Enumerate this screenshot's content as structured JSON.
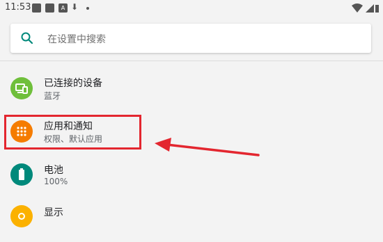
{
  "status_bar": {
    "time": "11:53"
  },
  "search": {
    "placeholder": "在设置中搜索"
  },
  "settings_items": [
    {
      "title": "已连接的设备",
      "subtitle": "蓝牙",
      "icon": "devices-icon",
      "color": "#6fbf3b"
    },
    {
      "title": "应用和通知",
      "subtitle": "权限、默认应用",
      "icon": "apps-icon",
      "color": "#f57c00"
    },
    {
      "title": "电池",
      "subtitle": "100%",
      "icon": "battery-icon",
      "color": "#00897b"
    },
    {
      "title": "显示",
      "subtitle": "",
      "icon": "display-icon",
      "color": "#fbb100"
    }
  ],
  "annotation": {
    "highlight_color": "#e3262f"
  }
}
